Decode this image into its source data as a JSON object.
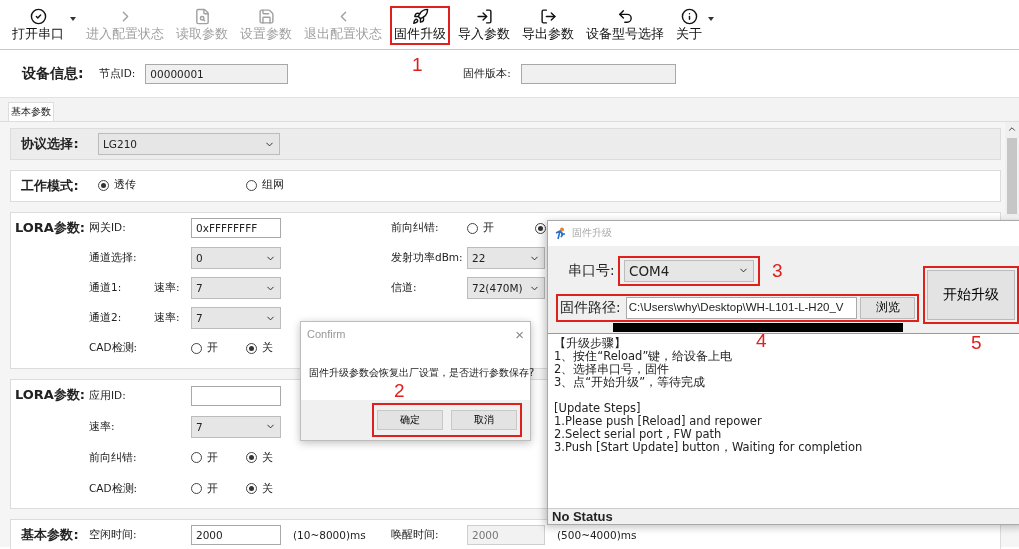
{
  "toolbar": [
    {
      "label": "打开串口",
      "disabled": false,
      "dropdown": true
    },
    {
      "label": "进入配置状态",
      "disabled": true,
      "dropdown": false
    },
    {
      "label": "读取参数",
      "disabled": true,
      "dropdown": false
    },
    {
      "label": "设置参数",
      "disabled": true,
      "dropdown": false
    },
    {
      "label": "退出配置状态",
      "disabled": true,
      "dropdown": false
    },
    {
      "label": "固件升级",
      "disabled": false,
      "dropdown": false,
      "callout": "1"
    },
    {
      "label": "导入参数",
      "disabled": false,
      "dropdown": false
    },
    {
      "label": "导出参数",
      "disabled": false,
      "dropdown": false
    },
    {
      "label": "设备型号选择",
      "disabled": false,
      "dropdown": false
    },
    {
      "label": "关于",
      "disabled": false,
      "dropdown": true
    }
  ],
  "device_info": {
    "title": "设备信息:",
    "node_id_label": "节点ID:",
    "node_id": "00000001",
    "firmware_label": "固件版本:"
  },
  "tabs": [
    {
      "label": "基本参数",
      "selected": true
    }
  ],
  "sections": [
    {
      "title": "协议选择:",
      "shaded": true,
      "rows": [
        {
          "left": [
            {
              "kind": "select",
              "value": "LG210"
            }
          ]
        }
      ]
    },
    {
      "title": "工作模式:",
      "shaded": false,
      "rows": [
        {
          "left": [
            {
              "kind": "radio",
              "label": "透传",
              "selected": true
            },
            {
              "kind": "radio",
              "label": "组网",
              "selected": false
            }
          ]
        }
      ]
    },
    {
      "title": "LORA参数:",
      "shaded": false,
      "rows": [
        {
          "left": [
            {
              "kind": "label",
              "text": "网关ID:"
            },
            {
              "kind": "input",
              "value": "0xFFFFFFFF",
              "disabled": false
            }
          ],
          "right": [
            {
              "kind": "label",
              "text": "前向纠错:"
            },
            {
              "kind": "radio",
              "label": "开",
              "selected": false
            },
            {
              "kind": "radio",
              "selected": true
            }
          ]
        },
        {
          "left": [
            {
              "kind": "label",
              "text": "通道选择:"
            },
            {
              "kind": "select",
              "value": "0"
            }
          ],
          "right": [
            {
              "kind": "label",
              "text": "发射功率dBm:"
            },
            {
              "kind": "select",
              "value": "22"
            }
          ]
        },
        {
          "left": [
            {
              "kind": "label",
              "text": "通道1:"
            },
            {
              "kind": "sublabel",
              "text": "速率:"
            },
            {
              "kind": "select",
              "value": "7"
            }
          ],
          "right": [
            {
              "kind": "label",
              "text": "信道:"
            },
            {
              "kind": "select",
              "value": "72(470M)"
            }
          ]
        },
        {
          "left": [
            {
              "kind": "label",
              "text": "通道2:"
            },
            {
              "kind": "sublabel",
              "text": "速率:"
            },
            {
              "kind": "select",
              "value": "7"
            }
          ]
        },
        {
          "left": [
            {
              "kind": "label",
              "text": "CAD检测:"
            },
            {
              "kind": "radio",
              "label": "开",
              "selected": false
            },
            {
              "kind": "radio",
              "label": "关",
              "selected": true
            }
          ]
        }
      ]
    },
    {
      "title": "LORA参数:",
      "shaded": false,
      "rows": [
        {
          "left": [
            {
              "kind": "label",
              "text": "应用ID:"
            },
            {
              "kind": "input",
              "disabled": false
            }
          ]
        },
        {
          "left": [
            {
              "kind": "label",
              "text": "速率:"
            },
            {
              "kind": "select",
              "value": "7"
            }
          ]
        },
        {
          "left": [
            {
              "kind": "label",
              "text": "前向纠错:"
            },
            {
              "kind": "radio",
              "label": "开",
              "selected": false
            },
            {
              "kind": "radio",
              "label": "关",
              "selected": true
            }
          ]
        },
        {
          "left": [
            {
              "kind": "label",
              "text": "CAD检测:"
            },
            {
              "kind": "radio",
              "label": "开",
              "selected": false
            },
            {
              "kind": "radio",
              "label": "关",
              "selected": true
            }
          ]
        }
      ]
    },
    {
      "title": "基本参数:",
      "shaded": false,
      "rows": [
        {
          "left": [
            {
              "kind": "label",
              "text": "空闲时间:"
            },
            {
              "kind": "input",
              "value": "2000",
              "disabled": false
            },
            {
              "kind": "note",
              "text": "(10~8000)ms"
            }
          ],
          "right": [
            {
              "kind": "label",
              "text": "唤醒时间:"
            },
            {
              "kind": "input",
              "value": "2000",
              "disabled": true
            },
            {
              "kind": "note",
              "text": "(500~4000)ms"
            }
          ]
        }
      ]
    }
  ],
  "confirm": {
    "title": "Confirm",
    "close": "×",
    "message": "固件升级参数会恢复出厂设置，是否进行参数保存?",
    "callout": "2",
    "buttons": [
      "确定",
      "取消"
    ]
  },
  "upgrade_window": {
    "title": "固件升级",
    "port_label": "串口号:",
    "port": "COM4",
    "port_callout": "3",
    "path_label": "固件路径:",
    "path": "C:\\Users\\why\\Desktop\\WH-L101-L-H20_V",
    "browse": "浏览",
    "path_callout": "4",
    "start": "开始升级",
    "start_callout": "5",
    "log": [
      [
        "【升级步骤】",
        "1、按住“Reload”键，给设备上电",
        "2、选择串口号，固件",
        "3、点“开始升级”，等待完成"
      ],
      [
        "[Update Steps]",
        "1.Please push [Reload] and repower",
        "2.Select serial port , FW path",
        "3.Push [Start Update] button，Waiting for completion"
      ]
    ],
    "status": "No Status"
  }
}
